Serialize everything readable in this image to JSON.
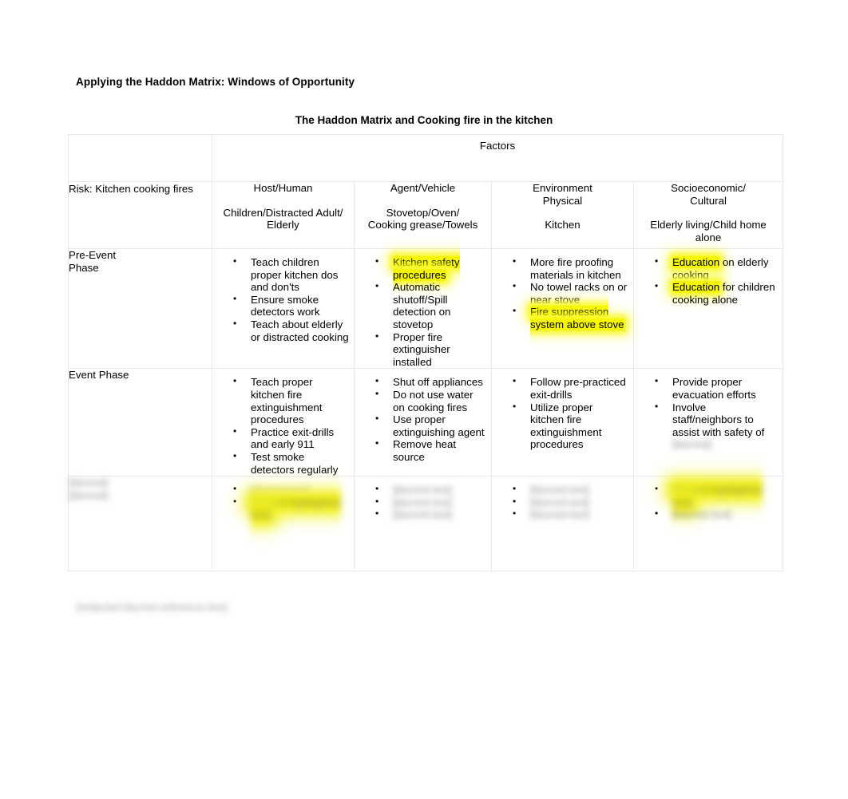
{
  "document": {
    "heading": "Applying the Haddon Matrix: Windows of Opportunity",
    "table_title": "The Haddon Matrix and Cooking fire in the kitchen",
    "footer_note": "[redacted blurred reference line]"
  },
  "table": {
    "factors_label": "Factors",
    "risk_label": "Risk: Kitchen cooking fires",
    "columns": [
      {
        "key": "host",
        "title_lines": [
          "Host/Human"
        ],
        "subtitle_lines": [
          "Children/Distracted Adult/",
          "Elderly"
        ]
      },
      {
        "key": "agent",
        "title_lines": [
          "Agent/Vehicle"
        ],
        "subtitle_lines": [
          "Stovetop/Oven/",
          "Cooking grease/Towels"
        ]
      },
      {
        "key": "environment",
        "title_lines": [
          "Environment",
          "Physical"
        ],
        "subtitle_lines": [
          "Kitchen"
        ]
      },
      {
        "key": "socioeconomic",
        "title_lines": [
          "Socioeconomic/",
          "Cultural"
        ],
        "subtitle_lines": [
          "Elderly living/Child home",
          "alone"
        ]
      }
    ],
    "rows": [
      {
        "key": "pre_event",
        "phase_lines": [
          "Pre-Event",
          "Phase"
        ],
        "redacted": false,
        "cells": {
          "host": [
            {
              "segments": [
                {
                  "text": "Teach children proper kitchen dos and don'ts",
                  "highlight": false
                }
              ]
            },
            {
              "segments": [
                {
                  "text": "Ensure smoke detectors work",
                  "highlight": false
                }
              ]
            },
            {
              "segments": [
                {
                  "text": "Teach about elderly or distracted cooking",
                  "highlight": false
                }
              ]
            }
          ],
          "agent": [
            {
              "segments": [
                {
                  "text": "Kitchen safety procedures",
                  "highlight": true
                }
              ]
            },
            {
              "segments": [
                {
                  "text": "Automatic shutoff/Spill detection on stovetop",
                  "highlight": false
                }
              ]
            },
            {
              "segments": [
                {
                  "text": "Proper fire extinguisher installed",
                  "highlight": false
                }
              ]
            }
          ],
          "environment": [
            {
              "segments": [
                {
                  "text": "More fire proofing materials in kitchen",
                  "highlight": false
                }
              ]
            },
            {
              "segments": [
                {
                  "text": "No towel racks on or near stove",
                  "highlight": false
                }
              ]
            },
            {
              "segments": [
                {
                  "text": "Fire suppression system above stove",
                  "highlight": true
                }
              ]
            }
          ],
          "socioeconomic": [
            {
              "segments": [
                {
                  "text": "Education",
                  "highlight": true
                },
                {
                  "text": " on elderly cooking",
                  "highlight": false
                }
              ]
            },
            {
              "segments": [
                {
                  "text": "Education",
                  "highlight": true
                },
                {
                  "text": " for children cooking alone",
                  "highlight": false
                }
              ]
            }
          ]
        }
      },
      {
        "key": "event",
        "phase_lines": [
          "Event Phase"
        ],
        "redacted": false,
        "cells": {
          "host": [
            {
              "segments": [
                {
                  "text": "Teach proper kitchen fire extinguishment procedures",
                  "highlight": false
                }
              ]
            },
            {
              "segments": [
                {
                  "text": "Practice exit-drills and early 911",
                  "highlight": false
                }
              ]
            },
            {
              "segments": [
                {
                  "text": "Test smoke detectors regularly",
                  "highlight": false
                }
              ]
            }
          ],
          "agent": [
            {
              "segments": [
                {
                  "text": "Shut off appliances",
                  "highlight": false
                }
              ]
            },
            {
              "segments": [
                {
                  "text": "Do not use water on cooking fires",
                  "highlight": false
                }
              ]
            },
            {
              "segments": [
                {
                  "text": "Use proper extinguishing agent",
                  "highlight": false
                }
              ]
            },
            {
              "segments": [
                {
                  "text": "Remove heat source",
                  "highlight": false
                }
              ]
            }
          ],
          "environment": [
            {
              "segments": [
                {
                  "text": "Follow pre-practiced exit-drills",
                  "highlight": false
                }
              ]
            },
            {
              "segments": [
                {
                  "text": "Utilize proper kitchen fire extinguishment procedures",
                  "highlight": false
                }
              ]
            }
          ],
          "socioeconomic": [
            {
              "segments": [
                {
                  "text": "Provide proper evacuation efforts",
                  "highlight": false
                }
              ]
            },
            {
              "segments": [
                {
                  "text": "Involve staff/neighbors to assist with safety of",
                  "highlight": false
                },
                {
                  "text": " [blurred]",
                  "highlight": false,
                  "blurred": true
                }
              ]
            }
          ]
        }
      },
      {
        "key": "post_event",
        "phase_lines": [
          "[blurred]",
          "[blurred]"
        ],
        "redacted": true,
        "cells": {
          "host": [
            {
              "segments": [
                {
                  "text": "[blurred text]",
                  "highlight": false
                }
              ]
            },
            {
              "segments": [
                {
                  "text": "[blurred highlighted text]",
                  "highlight": true
                }
              ]
            }
          ],
          "agent": [
            {
              "segments": [
                {
                  "text": "[blurred text]",
                  "highlight": false
                }
              ]
            },
            {
              "segments": [
                {
                  "text": "[blurred text]",
                  "highlight": false
                }
              ]
            },
            {
              "segments": [
                {
                  "text": "[blurred text]",
                  "highlight": false
                }
              ]
            }
          ],
          "environment": [
            {
              "segments": [
                {
                  "text": "[blurred text]",
                  "highlight": false
                }
              ]
            },
            {
              "segments": [
                {
                  "text": "[blurred text]",
                  "highlight": false
                }
              ]
            },
            {
              "segments": [
                {
                  "text": "[blurred text]",
                  "highlight": false
                }
              ]
            }
          ],
          "socioeconomic": [
            {
              "segments": [
                {
                  "text": "[blurred highlighted text]",
                  "highlight": true
                }
              ]
            },
            {
              "segments": [
                {
                  "text": "[blurred text]",
                  "highlight": false
                }
              ]
            }
          ]
        }
      }
    ]
  },
  "colors": {
    "highlight": "#f7f700",
    "border": "#e8e8e8",
    "text": "#000000",
    "page_background": "#ffffff"
  }
}
